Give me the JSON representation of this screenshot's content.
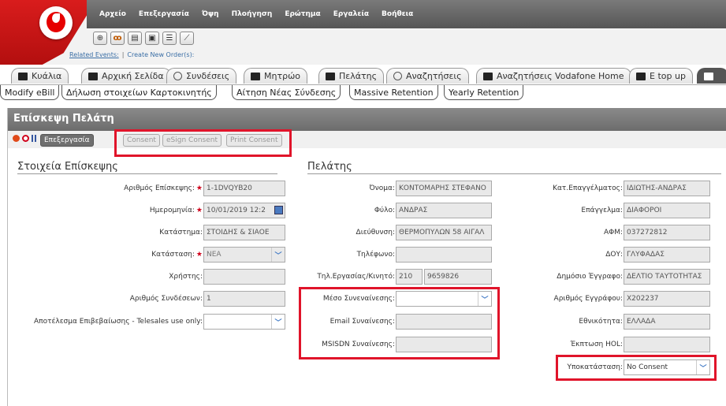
{
  "menu": [
    "Αρχείο",
    "Επεξεργασία",
    "Όψη",
    "Πλοήγηση",
    "Ερώτημα",
    "Εργαλεία",
    "Βοήθεια"
  ],
  "toolbar_icons": [
    "back-icon",
    "binoculars-icon",
    "new-record-icon",
    "copy-record-icon",
    "list-icon",
    "chart-icon"
  ],
  "links": {
    "related": "Related Events:",
    "sep": "|",
    "create": "Create New Order(s):"
  },
  "tabs": [
    "Κυάλια",
    "Αρχική Σελίδα",
    "Συνδέσεις",
    "Μητρώο",
    "Πελάτης",
    "Αναζητήσεις",
    "Αναζητήσεις Vodafone Home",
    "E top up"
  ],
  "subtabs": [
    "Modify eBill",
    "Δήλωση στοιχείων Καρτοκινητής",
    "Αίτηση Νέας Σύνδεσης",
    "Massive Retention",
    "Yearly Retention"
  ],
  "panel": {
    "title": "Επίσκεψη Πελάτη",
    "buttons": {
      "edit": "Επεξεργασία",
      "consent": "Consent",
      "esign": "eSign Consent",
      "print": "Print Consent"
    }
  },
  "visit": {
    "section": "Στοιχεία Επίσκεψης",
    "req_mark": "★",
    "fields": [
      {
        "label": "Αριθμός Επίσκεψης:",
        "value": "1-1DVQYB20"
      },
      {
        "label": "Ημερομηνία:",
        "value": "10/01/2019 12:2"
      },
      {
        "label": "Κατάστημα:",
        "value": "ΣΤΟΙΔΗΣ & ΣΙΑΟΕ"
      },
      {
        "label": "Κατάσταση:",
        "value": "ΝΕΑ"
      },
      {
        "label": "Χρήστης:",
        "value": ""
      },
      {
        "label": "Αριθμός Συνδέσεων:",
        "value": "1"
      },
      {
        "label": "Αποτέλεσμα Επιβεβαίωσης - Telesales use only:",
        "value": ""
      }
    ]
  },
  "customer": {
    "section": "Πελάτης",
    "fields": [
      {
        "label": "Όνομα:",
        "value": "ΚΟΝΤΟΜΑΡΗΣ ΣΤΕΦΑΝΟ"
      },
      {
        "label": "Φύλο:",
        "value": "ΑΝΔΡΑΣ"
      },
      {
        "label": "Διεύθυνση:",
        "value": "ΘΕΡΜΟΠΥΛΩΝ  58 ΑΙΓΑΛ"
      },
      {
        "label": "Τηλέφωνο:",
        "value": ""
      },
      {
        "label": "Τηλ.Εργασίας/Κινητό:",
        "value": "210",
        "value2": "9659826"
      },
      {
        "label": "Μέσο Συνεναίνεσης:",
        "value": ""
      },
      {
        "label": "Email Συναίνεσης:",
        "value": ""
      },
      {
        "label": "MSISDN Συναίνεσης:",
        "value": ""
      }
    ],
    "right": [
      {
        "label": "Κατ.Επαγγέλματος:",
        "value": "ΙΔΙΩΤΗΣ-ΑΝΔΡΑΣ"
      },
      {
        "label": "Επάγγελμα:",
        "value": "ΔΙΑΦΟΡΟΙ"
      },
      {
        "label": "ΑΦΜ:",
        "value": "037272812"
      },
      {
        "label": "ΔΟΥ:",
        "value": "ΓΛΥΦΑΔΑΣ"
      },
      {
        "label": "Δημόσιο Έγγραφο:",
        "value": "ΔΕΛΤΙΟ ΤΑΥΤΟΤΗΤΑΣ"
      },
      {
        "label": "Αριθμός Εγγράφου:",
        "value": "Χ202237"
      },
      {
        "label": "Εθνικότητα:",
        "value": "ΕΛΛΑΔΑ"
      },
      {
        "label": "Έκπτωση HOL:",
        "value": ""
      },
      {
        "label": "Υποκατάσταση:",
        "value": "No Consent"
      }
    ]
  },
  "colors": {
    "highlight": "#e0142a",
    "header": "#7a7a7a",
    "brand": "#e60000"
  }
}
